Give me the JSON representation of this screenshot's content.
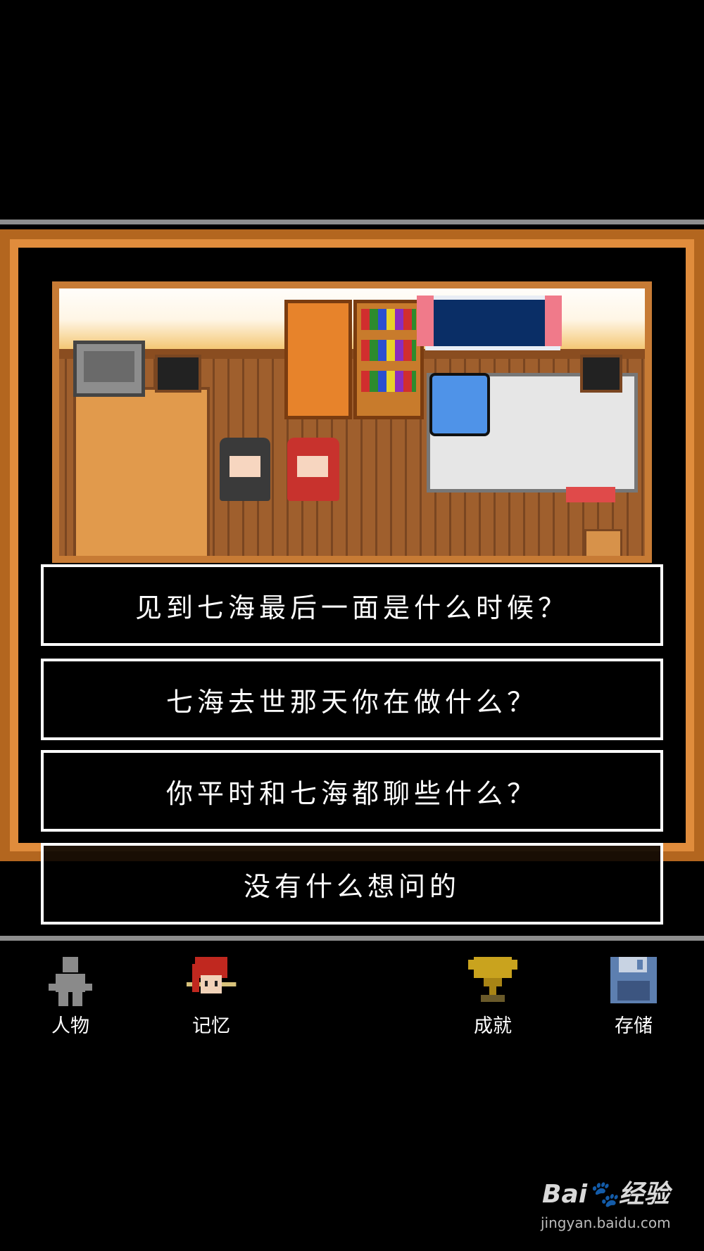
{
  "dialogue": {
    "choices": [
      "见到七海最后一面是什么时候？",
      "七海去世那天你在做什么？",
      "你平时和七海都聊些什么？",
      "没有什么想问的"
    ]
  },
  "menu": {
    "items": [
      {
        "label": "人物",
        "icon": "person-silhouette-icon"
      },
      {
        "label": "记忆",
        "icon": "red-hair-girl-icon"
      },
      {
        "label": "成就",
        "icon": "trophy-icon"
      },
      {
        "label": "存储",
        "icon": "floppy-disk-icon"
      }
    ]
  },
  "watermark": {
    "logo": "Bai🐾经验",
    "url": "jingyan.baidu.com"
  },
  "colors": {
    "frame": "#b3661f",
    "floor": "#9f5f2d",
    "trophy": "#c9a31e",
    "floppy": "#5d7fb0"
  }
}
